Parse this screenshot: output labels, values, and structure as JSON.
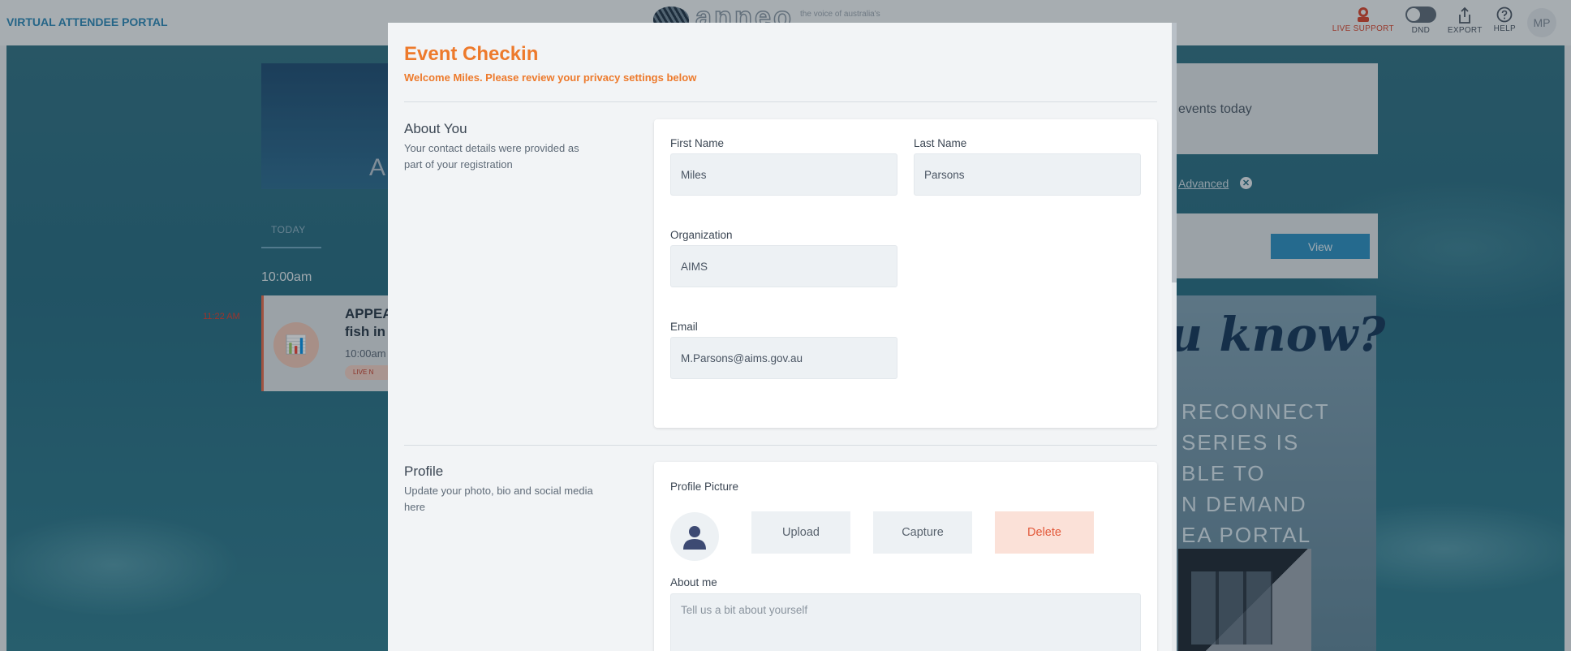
{
  "header": {
    "portal_title": "VIRTUAL ATTENDEE PORTAL",
    "logo_word": "anneo",
    "logo_tagline": "the voice of australia's",
    "tools": {
      "live_support": "LIVE SUPPORT",
      "dnd": "DND",
      "export": "EXPORT",
      "help": "HELP",
      "avatar_initials": "MP"
    }
  },
  "background": {
    "hero_letter": "A",
    "today_tab": "TODAY",
    "time_slot": "10:00am",
    "now_marker": "11:22 AM",
    "session_title_line1": "APPEA",
    "session_title_line2": "fish in",
    "session_time": "10:00am",
    "session_live": "LIVE N",
    "events_text": "events today",
    "advanced_link": "Advanced",
    "view_button": "View",
    "promo_script": "u know?",
    "promo_lines": [
      "RECONNECT",
      "SERIES IS",
      "BLE TO",
      "N DEMAND",
      "EA PORTAL"
    ]
  },
  "modal": {
    "title": "Event Checkin",
    "subtitle": "Welcome Miles. Please review your privacy settings below",
    "about": {
      "title": "About You",
      "desc": "Your contact details were provided as part of your registration",
      "first_name_label": "First Name",
      "first_name_value": "Miles",
      "last_name_label": "Last Name",
      "last_name_value": "Parsons",
      "organization_label": "Organization",
      "organization_value": "AIMS",
      "email_label": "Email",
      "email_value": "M.Parsons@aims.gov.au"
    },
    "profile": {
      "title": "Profile",
      "desc": "Update your photo, bio and social media here",
      "picture_label": "Profile Picture",
      "upload_label": "Upload",
      "capture_label": "Capture",
      "delete_label": "Delete",
      "about_me_label": "About me",
      "about_me_placeholder": "Tell us a bit about yourself"
    }
  },
  "colors": {
    "accent_orange": "#ed7a2c",
    "live_red": "#d9432a",
    "portal_blue": "#2a86b6",
    "delete_bg": "#fbe1d8"
  }
}
